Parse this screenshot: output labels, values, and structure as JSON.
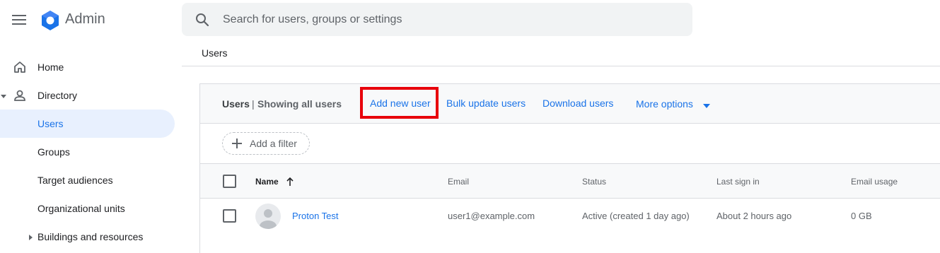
{
  "app": {
    "brand": "Admin"
  },
  "search": {
    "placeholder": "Search for users, groups or settings"
  },
  "sidebar": {
    "items": [
      {
        "label": "Home"
      },
      {
        "label": "Directory"
      },
      {
        "label": "Users"
      },
      {
        "label": "Groups"
      },
      {
        "label": "Target audiences"
      },
      {
        "label": "Organizational units"
      },
      {
        "label": "Buildings and resources"
      }
    ]
  },
  "breadcrumb": "Users",
  "panel": {
    "title": "Users",
    "separator": "|",
    "subtitle": "Showing all users",
    "actions": {
      "add": "Add new user",
      "bulk": "Bulk update users",
      "download": "Download users",
      "more": "More options"
    },
    "filter_label": "Add a filter"
  },
  "table": {
    "columns": [
      "Name",
      "Email",
      "Status",
      "Last sign in",
      "Email usage"
    ],
    "rows": [
      {
        "name": "Proton Test",
        "email": "user1@example.com",
        "status": "Active (created 1 day ago)",
        "last_sign_in": "About 2 hours ago",
        "email_usage": "0 GB"
      }
    ]
  },
  "colors": {
    "accent": "#1a73e8",
    "highlight": "#e8000b",
    "active_bg": "#e8f0fe"
  }
}
